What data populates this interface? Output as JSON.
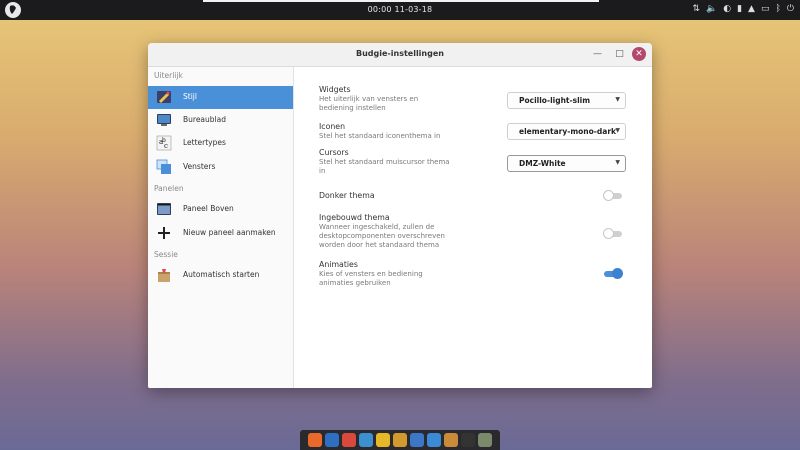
{
  "panel": {
    "clock": "00:00 11-03-18",
    "tray_icons": [
      "network-icon",
      "volume-icon",
      "night-light-icon",
      "power-icon",
      "notifications-icon",
      "folder-icon",
      "bluetooth-icon",
      "user-icon"
    ]
  },
  "window": {
    "title": "Budgie-instellingen",
    "minimize_glyph": "—",
    "maximize_glyph": "□",
    "close_glyph": "✕"
  },
  "sidebar": {
    "sections": [
      {
        "label": "Uiterlijk"
      },
      {
        "label": "Panelen"
      },
      {
        "label": "Sessie"
      }
    ],
    "items": [
      {
        "label": "Stijl",
        "icon": "brush-icon"
      },
      {
        "label": "Bureaublad",
        "icon": "desktop-icon"
      },
      {
        "label": "Lettertypes",
        "icon": "font-icon"
      },
      {
        "label": "Vensters",
        "icon": "windows-icon"
      },
      {
        "label": "Paneel Boven",
        "icon": "panel-icon"
      },
      {
        "label": "Nieuw paneel aanmaken",
        "icon": "plus-icon"
      },
      {
        "label": "Automatisch starten",
        "icon": "package-icon"
      }
    ]
  },
  "settings": {
    "widgets": {
      "name": "Widgets",
      "desc1": "Het uiterlijk van vensters en",
      "desc2": "bediening instellen",
      "value": "Pocillo-light-slim"
    },
    "icons": {
      "name": "Iconen",
      "desc1": "Stel het standaard iconenthema in",
      "value": "elementary-mono-dark"
    },
    "cursors": {
      "name": "Cursors",
      "desc1": "Stel het standaard muiscursor thema",
      "desc2": "in",
      "value": "DMZ-White"
    },
    "dark": {
      "name": "Donker thema",
      "enabled": false
    },
    "builtin": {
      "name": "Ingebouwd thema",
      "desc1": "Wanneer ingeschakeld, zullen de",
      "desc2": "desktopcomponenten overschreven",
      "desc3": "worden door het standaard thema",
      "enabled": false
    },
    "animations": {
      "name": "Animaties",
      "desc1": "Kies of vensters en bediening",
      "desc2": "animaties gebruiken",
      "enabled": true
    }
  },
  "dock": {
    "items": [
      "firefox-icon",
      "thunderbird-icon",
      "chromium-icon",
      "browser-icon",
      "app-icon",
      "files-icon",
      "calculator-icon",
      "store-icon",
      "settings-icon",
      "terminal-icon",
      "monitor-icon"
    ],
    "colors": [
      "#e8692a",
      "#2f6fc1",
      "#d94a3c",
      "#3d8fd0",
      "#e6b729",
      "#d29a2e",
      "#3b76c7",
      "#3b8ad6",
      "#c98a3a",
      "#333333",
      "#7a8a6a"
    ]
  }
}
